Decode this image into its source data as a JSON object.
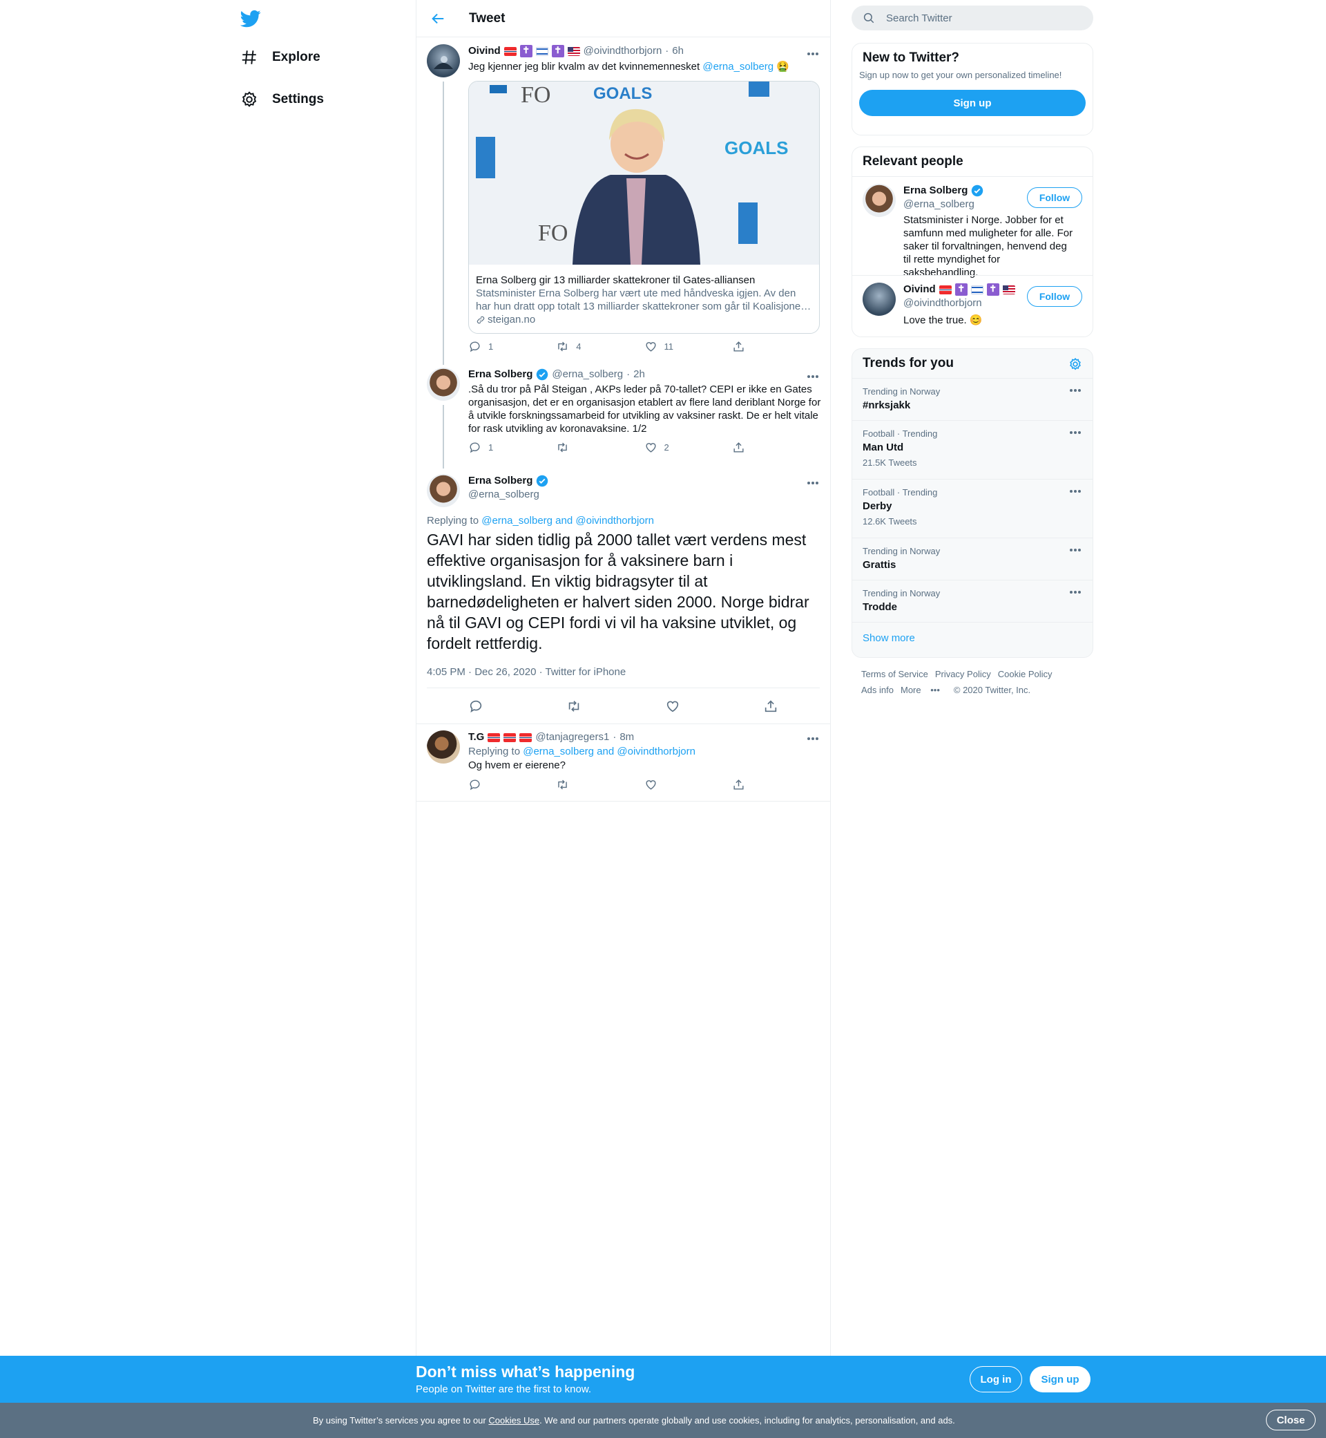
{
  "nav": {
    "explore": "Explore",
    "settings": "Settings"
  },
  "header": {
    "title": "Tweet"
  },
  "tweets": [
    {
      "name": "Oivind",
      "handle": "@oivindthorbjorn",
      "time": "6h",
      "text_pre": "Jeg kjenner jeg blir kvalm av det kvinnemennesket ",
      "mention": "@erna_solberg",
      "emoji": "🤮",
      "card": {
        "title": "Erna Solberg gir 13 milliarder skattekroner til Gates-alliansen",
        "desc": "Statsminister Erna Solberg har vært ute med håndveska igjen. Av den har hun dratt opp totalt 13 milliarder skattekroner som går til Koalisjone…",
        "domain": "steigan.no"
      },
      "replies": "1",
      "retweets": "4",
      "likes": "11"
    },
    {
      "name": "Erna Solberg",
      "handle": "@erna_solberg",
      "time": "2h",
      "text": ".Så du tror på Pål Steigan , AKPs leder på 70-tallet?   CEPI  er ikke en Gates organisasjon, det er en organisasjon etablert av flere land deriblant Norge for å utvikle forskningssamarbeid for utvikling av vaksiner raskt. De er helt vitale for rask utvikling av koronavaksine. 1/2",
      "replies": "1",
      "retweets": "",
      "likes": "2"
    }
  ],
  "focus": {
    "name": "Erna Solberg",
    "handle": "@erna_solberg",
    "replying_label": "Replying to ",
    "replying_to": "@erna_solberg and @oivindthorbjorn",
    "text": "GAVI har siden tidlig på 2000 tallet vært verdens mest effektive organisasjon for å vaksinere barn i utviklingsland. En viktig bidragsyter til at barnedødeligheten er halvert siden 2000.  Norge bidrar nå til GAVI og CEPI fordi vi vil ha vaksine utviklet, og fordelt rettferdig.",
    "meta": "4:05 PM · Dec 26, 2020 · Twitter for iPhone"
  },
  "reply": {
    "name": "T.G",
    "handle": "@tanjagregers1",
    "time": "8m",
    "replying_label": "Replying to ",
    "replying_to": "@erna_solberg and @oivindthorbjorn",
    "text": "Og hvem er eierene?"
  },
  "sidebar": {
    "search_placeholder": "Search Twitter",
    "new": {
      "title": "New to Twitter?",
      "sub": "Sign up now to get your own personalized timeline!",
      "signup": "Sign up"
    },
    "relevant": {
      "title": "Relevant people",
      "people": [
        {
          "name": "Erna Solberg",
          "handle": "@erna_solberg",
          "follow": "Follow",
          "bio": "Statsminister i Norge. Jobber for et samfunn med muligheter for alle. For saker til forvaltningen, henvend deg til rette myndighet for saksbehandling."
        },
        {
          "name": "Oivind",
          "handle": "@oivindthorbjorn",
          "follow": "Follow",
          "bio": "Love the true. 😊"
        }
      ]
    },
    "trends": {
      "title": "Trends for you",
      "items": [
        {
          "meta": "Trending in Norway",
          "name": "#nrksjakk",
          "count": ""
        },
        {
          "meta": "Football · Trending",
          "name": "Man Utd",
          "count": "21.5K Tweets"
        },
        {
          "meta": "Football · Trending",
          "name": "Derby",
          "count": "12.6K Tweets"
        },
        {
          "meta": "Trending in Norway",
          "name": "Grattis",
          "count": ""
        },
        {
          "meta": "Trending in Norway",
          "name": "Trodde",
          "count": ""
        }
      ],
      "show_more": "Show more"
    },
    "footer": {
      "terms": "Terms of Service",
      "privacy": "Privacy Policy",
      "cookie": "Cookie Policy",
      "ads": "Ads info",
      "more": "More",
      "copyright": "© 2020 Twitter, Inc."
    }
  },
  "bottom": {
    "heading": "Don’t miss what’s happening",
    "sub": "People on Twitter are the first to know.",
    "login": "Log in",
    "signup": "Sign up"
  },
  "cookie": {
    "pre": "By using Twitter’s services you agree to our ",
    "link": "Cookies Use",
    "post": ". We and our partners operate globally and use cookies, including for analytics, personalisation, and ads.",
    "close": "Close"
  },
  "colors": {
    "accent": "#1da1f2",
    "muted": "#5b7083",
    "cookie_bg": "#5b7083"
  }
}
